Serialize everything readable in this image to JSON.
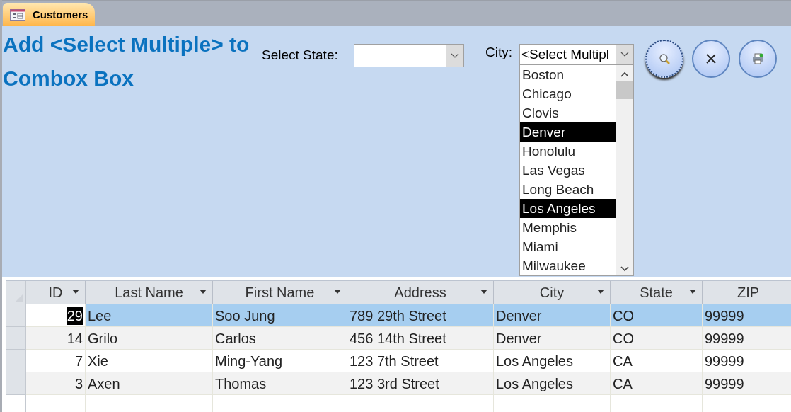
{
  "document_tab": {
    "label": "Customers",
    "selected": true
  },
  "form": {
    "heading": "Add <Select Multiple> to Combox Box",
    "state_filter": {
      "label": "Select State:"
    },
    "city_filter": {
      "label": "City:",
      "value": "<Select Multipl",
      "expanded": true,
      "options": [
        {
          "label": "Boston",
          "selected": false
        },
        {
          "label": "Chicago",
          "selected": false
        },
        {
          "label": "Clovis",
          "selected": false
        },
        {
          "label": "Denver",
          "selected": true
        },
        {
          "label": "Honolulu",
          "selected": false
        },
        {
          "label": "Las Vegas",
          "selected": false
        },
        {
          "label": "Long Beach",
          "selected": false
        },
        {
          "label": "Los Angeles",
          "selected": true
        },
        {
          "label": "Memphis",
          "selected": false
        },
        {
          "label": "Miami",
          "selected": false
        },
        {
          "label": "Milwaukee",
          "selected": false
        }
      ]
    },
    "buttons": [
      {
        "kind": "search",
        "focused": true
      },
      {
        "kind": "clear",
        "focused": false
      },
      {
        "kind": "print",
        "focused": false
      }
    ]
  },
  "table": {
    "columns": [
      {
        "label": "ID",
        "filter": true
      },
      {
        "label": "Last Name",
        "filter": true
      },
      {
        "label": "First Name",
        "filter": true
      },
      {
        "label": "Address",
        "filter": true
      },
      {
        "label": "City",
        "filter": true
      },
      {
        "label": "State",
        "filter": true
      },
      {
        "label": "ZIP",
        "filter": false
      }
    ],
    "rows": [
      {
        "selected": true,
        "cells": [
          "29",
          "Lee",
          "Soo Jung",
          "789 29th Street",
          "Denver",
          "CO",
          "99999"
        ]
      },
      {
        "selected": false,
        "cells": [
          "14",
          "Grilo",
          "Carlos",
          "456 14th Street",
          "Denver",
          "CO",
          "99999"
        ]
      },
      {
        "selected": false,
        "cells": [
          "7",
          "Xie",
          "Ming-Yang",
          "123 7th Street",
          "Los Angeles",
          "CA",
          "99999"
        ]
      },
      {
        "selected": false,
        "cells": [
          "3",
          "Axen",
          "Thomas",
          "123 3rd Street",
          "Los Angeles",
          "CA",
          "99999"
        ]
      }
    ]
  }
}
